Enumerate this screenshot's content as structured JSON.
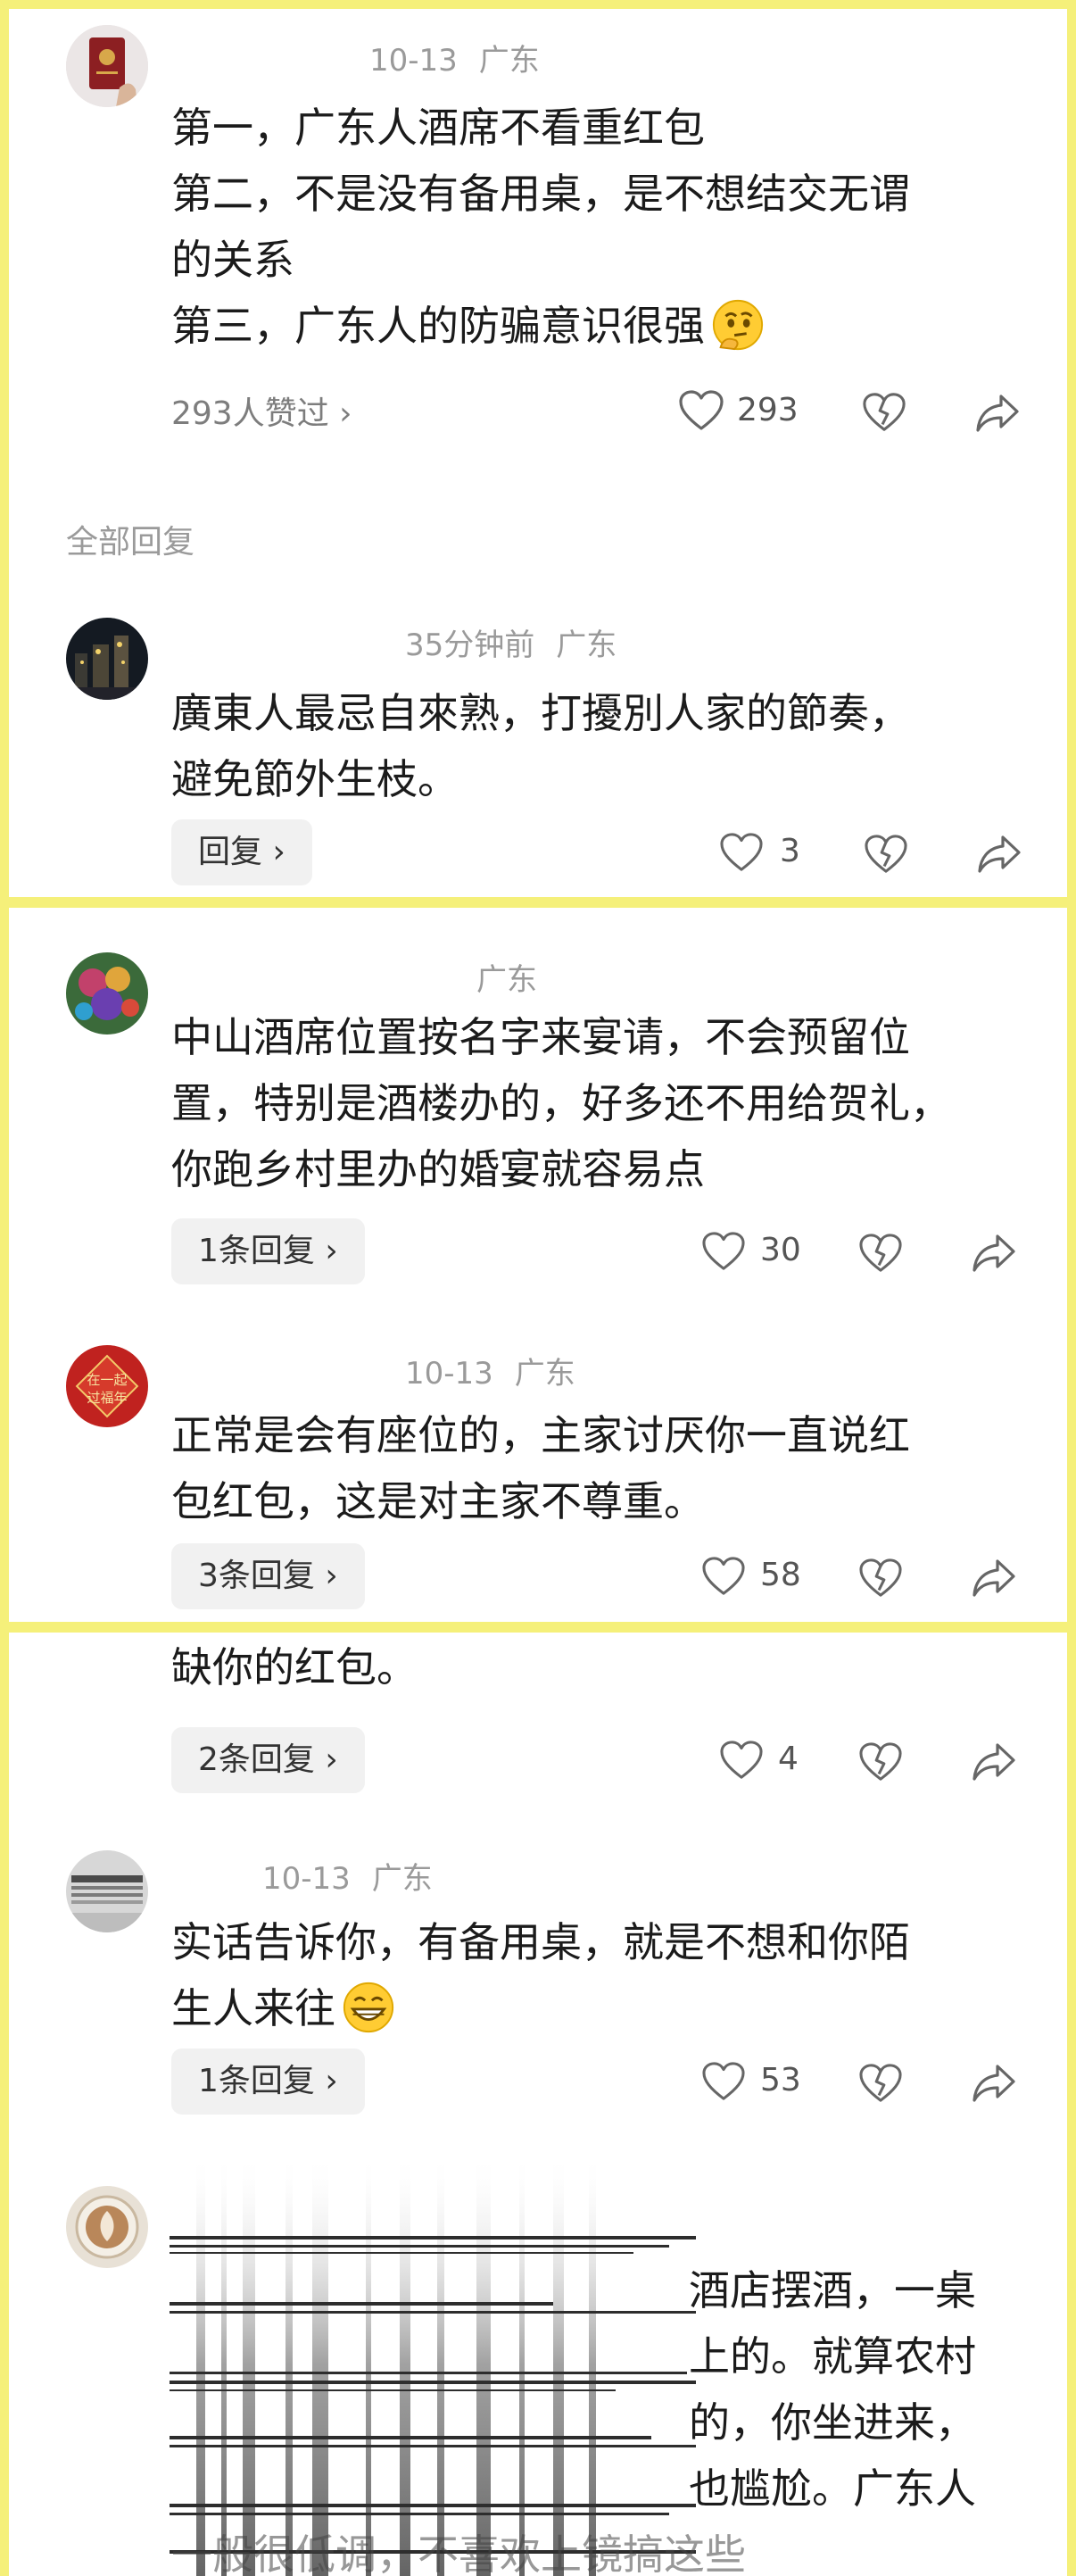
{
  "colors": {
    "background": "#f5f07a",
    "text": "#1b1b1b",
    "meta": "#9a9a9a"
  },
  "top_comment": {
    "date": "10-13",
    "location": "广东",
    "lines": [
      "第一，广东人酒席不看重红包",
      "第二，不是没有备用桌，是不想结交无谓",
      "的关系",
      "第三，广东人的防骗意识很强"
    ],
    "emoji": "thinking-face",
    "liked_by": "293人赞过 ›",
    "like_count": "293"
  },
  "section_title": "全部回复",
  "reply_1": {
    "time": "35分钟前",
    "location": "广东",
    "lines": [
      "廣東人最忌自來熟，打擾別人家的節奏，",
      "避免節外生枝。"
    ],
    "reply_label": "回复 ›",
    "like_count": "3"
  },
  "comment_2": {
    "location": "广东",
    "lines": [
      "中山酒席位置按名字来宴请，不会预留位",
      "置，特别是酒楼办的，好多还不用给贺礼，",
      "你跑乡村里办的婚宴就容易点"
    ],
    "reply_label": "1条回复 ›",
    "like_count": "30"
  },
  "comment_3": {
    "date": "10-13",
    "location": "广东",
    "avatar_text": "在一起 过福年",
    "lines": [
      "正常是会有座位的，主家讨厌你一直说红",
      "包红包，这是对主家不尊重。"
    ],
    "reply_label": "3条回复 ›",
    "like_count": "58"
  },
  "comment_4": {
    "lines": [
      "缺你的红包。"
    ],
    "reply_label": "2条回复 ›",
    "like_count": "4"
  },
  "comment_5": {
    "date": "10-13",
    "location": "广东",
    "lines": [
      "实话告诉你，有备用桌，就是不想和你陌",
      "生人来往"
    ],
    "emoji": "grinning-face",
    "reply_label": "1条回复 ›",
    "like_count": "53"
  },
  "comment_6": {
    "lines": [
      "酒店摆酒，一桌",
      "上的。就算农村",
      "的，你坐进来，",
      "也尴尬。广东人",
      "一般很低调，不喜欢上镜搞这些"
    ]
  }
}
